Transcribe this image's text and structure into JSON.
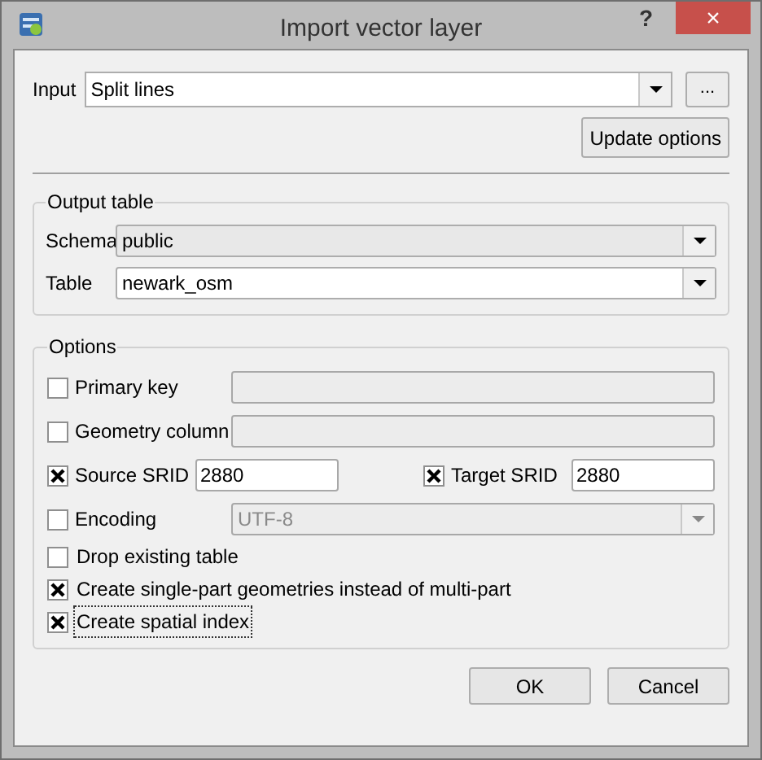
{
  "window": {
    "title": "Import vector layer",
    "help_button": "?",
    "close_button": "×"
  },
  "input": {
    "label": "Input",
    "value": "Split lines",
    "browse_button": "..."
  },
  "update_button": "Update options",
  "output_table": {
    "title": "Output table",
    "fields": [
      {
        "label": "Schema",
        "value": "public",
        "editable": false
      },
      {
        "label": "Table",
        "value": "newark_osm",
        "editable": true
      }
    ]
  },
  "options": {
    "title": "Options",
    "rows": [
      {
        "kind": "field",
        "label": "Primary key",
        "checked": false
      },
      {
        "kind": "field",
        "label": "Geometry column",
        "checked": false
      },
      {
        "kind": "pair",
        "items": [
          {
            "label": "Source SRID",
            "checked": true,
            "value": "2880"
          },
          {
            "label": "Target SRID",
            "checked": true,
            "value": "2880"
          }
        ]
      },
      {
        "kind": "select",
        "label": "Encoding",
        "checked": false,
        "value": "UTF-8"
      },
      {
        "kind": "check",
        "label": "Drop existing table",
        "checked": false,
        "focused": false
      },
      {
        "kind": "check",
        "label": "Create single-part geometries instead of multi-part",
        "checked": true,
        "focused": false
      },
      {
        "kind": "check",
        "label": "Create spatial index",
        "checked": true,
        "focused": true
      }
    ]
  },
  "buttons": [
    "OK",
    "Cancel"
  ]
}
